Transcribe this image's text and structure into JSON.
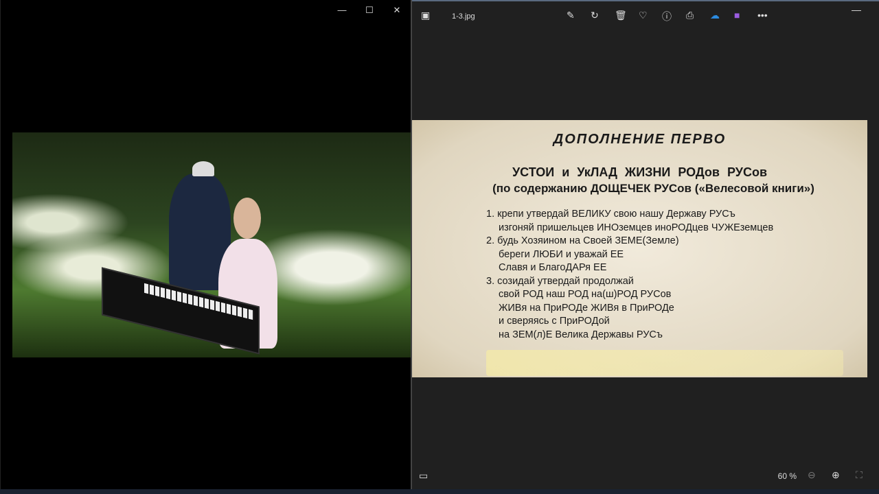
{
  "left_window": {
    "controls": {
      "minimize": "—",
      "maximize": "☐",
      "close": "✕"
    }
  },
  "viewer": {
    "filename": "1-3.jpg",
    "toolbar_icons": [
      "edit-image-icon",
      "rotate-icon",
      "delete-icon",
      "favorite-icon",
      "info-icon",
      "print-icon",
      "onedrive-icon",
      "clipchamp-icon",
      "more-icon"
    ],
    "minimize": "—",
    "zoom_level": "60 %",
    "document": {
      "title": "ДОПОЛНЕНИЕ ПЕРВО",
      "heading1": "УСТОИ и УкЛАД ЖИЗНИ РОДов РУСов",
      "heading2": "(по содержанию ДОЩЕЧЕК РУСов («Велесовой книги»)",
      "lines": [
        "1. крепи утвердай ВЕЛИКУ свою нашу Державу РУСъ",
        "изгоняй пришельцев ИНОземцев иноРОДцев ЧУЖЕземцев",
        "2. будь Хозяином на Своей ЗЕМЕ(Земле)",
        "береги ЛЮБИ и уважай ЕЕ",
        "Славя и БлагоДАРя ЕЕ",
        "3. созидай утвердай продолжай",
        "свой РОД наш РОД на(ш)РОД РУСов",
        "ЖИВя на ПриРОДе ЖИВя в ПриРОДе",
        "и сверяясь с ПриРОДой",
        "на ЗЕМ(л)Е Велика Державы РУСъ"
      ]
    }
  }
}
